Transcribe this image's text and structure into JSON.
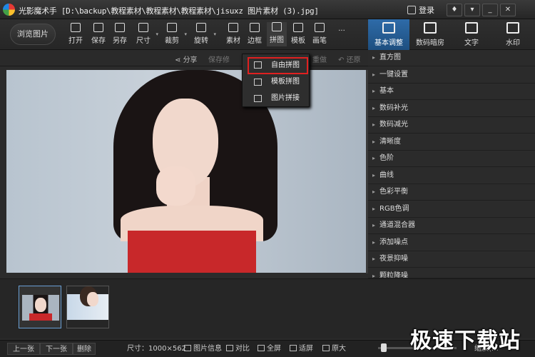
{
  "window": {
    "title": "光影魔术手 [D:\\backup\\教程素材\\教程素材\\教程素材\\jisuxz 图片素材 (3).jpg]",
    "login_label": "登录",
    "controls": [
      "shirt-icon",
      "minimize",
      "maximize",
      "close"
    ]
  },
  "toolbar": {
    "browse_label": "浏览图片",
    "tools": [
      {
        "label": "打开",
        "icon": "open-icon"
      },
      {
        "label": "保存",
        "icon": "save-icon"
      },
      {
        "label": "另存",
        "icon": "save-as-icon"
      },
      {
        "label": "尺寸",
        "icon": "resize-icon"
      },
      {
        "label": "裁剪",
        "icon": "crop-icon"
      },
      {
        "label": "旋转",
        "icon": "rotate-icon"
      },
      {
        "label": "素材",
        "icon": "material-icon"
      },
      {
        "label": "边框",
        "icon": "border-icon"
      },
      {
        "label": "拼图",
        "icon": "collage-icon"
      },
      {
        "label": "模板",
        "icon": "template-icon"
      },
      {
        "label": "画笔",
        "icon": "brush-icon"
      },
      {
        "label": "...",
        "icon": "more-icon"
      }
    ]
  },
  "right_tabs": [
    {
      "label": "基本调整",
      "icon": "adjust-icon",
      "active": true
    },
    {
      "label": "数码暗房",
      "icon": "camera-icon",
      "active": false
    },
    {
      "label": "文字",
      "icon": "text-icon",
      "active": false
    },
    {
      "label": "水印",
      "icon": "watermark-icon",
      "active": false
    }
  ],
  "subbar": {
    "share": "分享",
    "save_partial": "保存修",
    "redo": "重做",
    "restore": "还原"
  },
  "collage_menu": {
    "items": [
      {
        "label": "自由拼图",
        "highlighted": true
      },
      {
        "label": "模板拼图",
        "highlighted": false
      },
      {
        "label": "图片拼接",
        "highlighted": false
      }
    ]
  },
  "adjust_panel": {
    "items": [
      "直方图",
      "一键设置",
      "基本",
      "数码补光",
      "数码减光",
      "清晰度",
      "色阶",
      "曲线",
      "色彩平衡",
      "RGB色调",
      "通道混合器",
      "添加噪点",
      "夜景抑噪",
      "颗粒降噪"
    ]
  },
  "statusbar": {
    "prev": "上一张",
    "next": "下一张",
    "delete": "删除",
    "size_label": "尺寸：1000×562",
    "info": "图片信息",
    "compare": "对比",
    "fullscreen": "全屏",
    "fit": "适屏",
    "original": "原大",
    "zoom_partial": "缩放(…"
  },
  "watermark": "极速下载站",
  "colors": {
    "accent": "#2e6ba8",
    "highlight_border": "#e02020",
    "background": "#2b2b2b"
  }
}
